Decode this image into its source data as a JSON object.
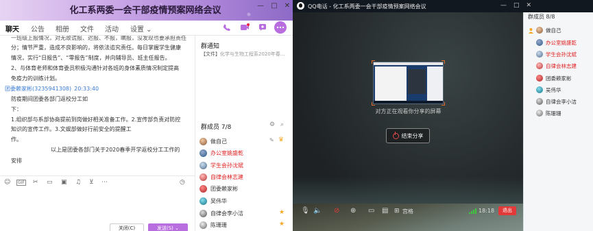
{
  "chat": {
    "title": "化工系两委一会干部疫情预案网络会议",
    "window_buttons": [
      "—",
      "□",
      "✕"
    ],
    "tabs": [
      "聊天",
      "公告",
      "相册",
      "文件",
      "活动",
      "设置 ⌄"
    ],
    "message_lines_top": [
      "一班级上报情况，对无故谎报、迟报、不报，瞒报，没发现也要承担责任",
      "分；情节严重，造成不良影响的，将依法追究责任。每日掌握学生健康",
      "情况，实行“日报告”、“零报告”制度，并向辅导员、班主任报告。",
      "2、与体育老师和体育委员积极沟通针对各班的身体素质情况制定提高",
      "免疫力的训练计划。"
    ],
    "sender": {
      "name": "团委赖家彬",
      "qq": "(3235941308)",
      "time": "20:33:40"
    },
    "message_lines_bottom": [
      "防疫期间团委各部门返校分工如",
      "下：",
      "1.组织部与系部协商提前到岗做好相关准备工作。2.宣传部负责对防控",
      "知识的宣传工作。3.文娱部做好行前安全的提醒工",
      "作。",
      "以上是团委各部门关于2020春季开学返校分工工作的",
      "安排"
    ],
    "notice": {
      "title": "群通知",
      "text_prefix": "【文件】",
      "text_body": "化学与生物工程系2020年春..."
    },
    "members_header": "群成员 7/8",
    "members": [
      {
        "name": "做自己",
        "red": false,
        "star": false
      },
      {
        "name": "办公室姚盛乾",
        "red": true,
        "star": false
      },
      {
        "name": "学生会孙沈斌",
        "red": true,
        "star": false
      },
      {
        "name": "自律会林志建",
        "red": true,
        "star": false
      },
      {
        "name": "团委赖家彬",
        "red": false,
        "star": false
      },
      {
        "name": "吴伟华",
        "red": false,
        "star": false
      },
      {
        "name": "自律会李小洁",
        "red": false,
        "star": true
      },
      {
        "name": "陈珊珊",
        "red": false,
        "star": true
      }
    ],
    "toolbar_icons": [
      "smile-icon",
      "gif-icon",
      "scissors-icon",
      "folder-icon",
      "image-icon",
      "bell-icon",
      "mic-icon",
      "more-icon",
      "history-icon"
    ],
    "close_button": "关闭(C)",
    "send_button": "发送(S) ⌄"
  },
  "call": {
    "title": "QQ电话 - 化工系两委一会干部疫情预案网络会议",
    "window_buttons": [
      "—",
      "□",
      "✕"
    ],
    "share_caption": "对方正在观看你分享的屏幕",
    "end_share_label": "结束分享",
    "toolbar": {
      "grid_label": "宫格",
      "time": "18:18",
      "exit_label": "退出",
      "signal_level": 4
    },
    "members_header": "群成员 8/8",
    "members": [
      {
        "name": "做自己",
        "red": false,
        "host": true
      },
      {
        "name": "办公室姚盛乾",
        "red": true,
        "host": false
      },
      {
        "name": "学生会孙沈斌",
        "red": true,
        "host": false
      },
      {
        "name": "自律会林志建",
        "red": true,
        "host": false
      },
      {
        "name": "团委赖家彬",
        "red": false,
        "host": false
      },
      {
        "name": "吴伟华",
        "red": false,
        "host": false
      },
      {
        "name": "自律会李小洁",
        "red": false,
        "host": false
      },
      {
        "name": "陈珊珊",
        "red": false,
        "host": false
      }
    ]
  },
  "colors": {
    "accent_purple": "#b96ee0",
    "link_blue": "#3a7bd5",
    "member_red": "#e02020",
    "exit_red": "#e23a3a",
    "signal_green": "#3ec73e"
  }
}
